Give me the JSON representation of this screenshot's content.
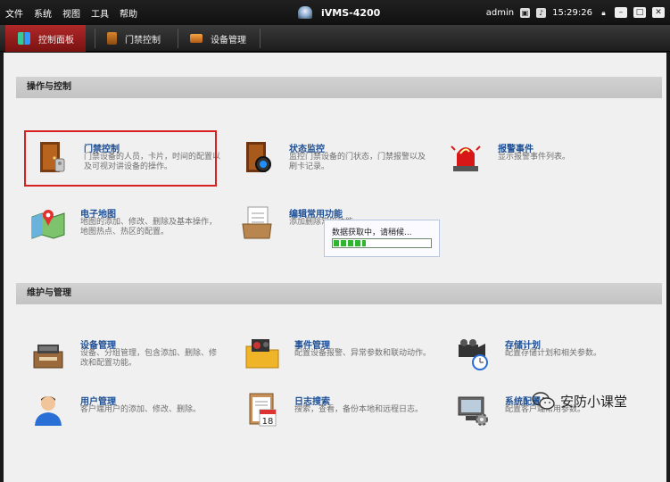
{
  "titlebar": {
    "menu": [
      "文件",
      "系统",
      "视图",
      "工具",
      "帮助"
    ],
    "app_title": "iVMS-4200",
    "user": "admin",
    "time": "15:29:26",
    "icons": [
      "lock-icon",
      "minimize-icon",
      "maximize-icon",
      "close-icon"
    ]
  },
  "tabs": [
    {
      "label": "控制面板",
      "active": true,
      "icon": "control-panel-icon"
    },
    {
      "label": "门禁控制",
      "active": false,
      "icon": "access-control-icon"
    },
    {
      "label": "设备管理",
      "active": false,
      "icon": "device-management-icon"
    }
  ],
  "sections": {
    "operation": {
      "title": "操作与控制",
      "items": [
        {
          "title": "门禁控制",
          "desc": "门禁设备的人员，卡片，时间的配置以及可视对讲设备的操作。",
          "icon": "door-icon"
        },
        {
          "title": "状态监控",
          "desc": "监控门禁设备的门状态，门禁报警以及刷卡记录。",
          "icon": "door-monitor-icon"
        },
        {
          "title": "报警事件",
          "desc": "显示报警事件列表。",
          "icon": "alarm-light-icon"
        },
        {
          "title": "电子地图",
          "desc": "地图的添加、修改、删除及基本操作，地图热点、热区的配置。",
          "icon": "map-icon"
        },
        {
          "title": "编辑常用功能",
          "desc": "添加删除常用功能。",
          "icon": "edit-functions-icon"
        }
      ]
    },
    "maintenance": {
      "title": "维护与管理",
      "items": [
        {
          "title": "设备管理",
          "desc": "设备、分组管理，包含添加、删除、修改和配置功能。",
          "icon": "device-icon"
        },
        {
          "title": "事件管理",
          "desc": "配置设备报警、异常参数和联动动作。",
          "icon": "event-folder-icon"
        },
        {
          "title": "存储计划",
          "desc": "配置存储计划和相关参数。",
          "icon": "camera-clock-icon"
        },
        {
          "title": "用户管理",
          "desc": "客户端用户的添加、修改、删除。",
          "icon": "user-icon"
        },
        {
          "title": "日志搜索",
          "desc": "搜索，查看，备份本地和远程日志。",
          "icon": "calendar-log-icon"
        },
        {
          "title": "系统配置",
          "desc": "配置客户端常用参数。",
          "icon": "monitor-gear-icon"
        }
      ]
    }
  },
  "progress": {
    "message": "数据获取中，请稍候...",
    "fraction": 0.33
  },
  "watermark": {
    "text": "安防小课堂"
  },
  "colors": {
    "accent": "#9e1e1e",
    "link": "#1e4f94",
    "highlight": "#d82020",
    "progress": "#2fb52f"
  }
}
